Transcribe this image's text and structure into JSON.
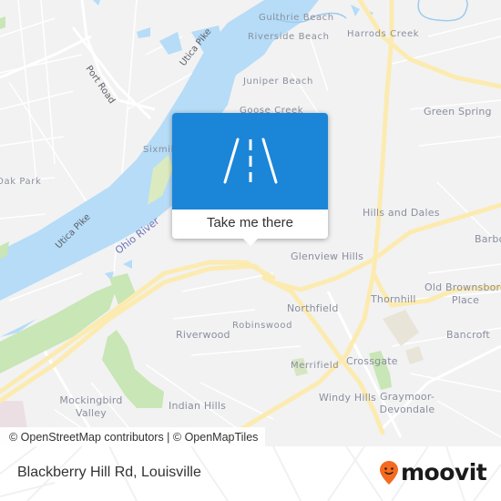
{
  "map": {
    "colors": {
      "land": "#f2f2f3",
      "water": "#b6dcf7",
      "park": "#c8e6b6",
      "major_road": "#fcebb0",
      "minor_road": "#ffffff",
      "industrial": "#e8e4d8",
      "label": "#8a8f9c",
      "road_label": "#5d6068",
      "river_label": "#6a74b8"
    },
    "place_labels": [
      "Gulthrie Beach",
      "Riverside Beach",
      "Harrods Creek",
      "Juniper Beach",
      "Goose Creek",
      "Green Spring",
      "Sixmile",
      "Oak Park",
      "Hills and Dales",
      "Barbourmeade",
      "Glenview Hills",
      "Northfield",
      "Thornhill",
      "Old Brownsboro Place",
      "Robinswood",
      "Riverwood",
      "Bancroft",
      "Merrifield",
      "Crossgate",
      "Windy Hills",
      "Graymoor-Devondale",
      "Mockingbird Valley",
      "Indian Hills"
    ],
    "road_labels": [
      "Port Road",
      "Utica Pike",
      "Utica Pike"
    ],
    "water_labels": [
      "Ohio River"
    ]
  },
  "popup": {
    "icon": "road-icon",
    "action_label": "Take me there",
    "accent_color": "#1b85d8"
  },
  "attribution": "© OpenStreetMap contributors | © OpenMapTiles",
  "footer": {
    "location": "Blackberry Hill Rd, Louisville",
    "brand": "moovit",
    "brand_color": "#f26b21"
  }
}
